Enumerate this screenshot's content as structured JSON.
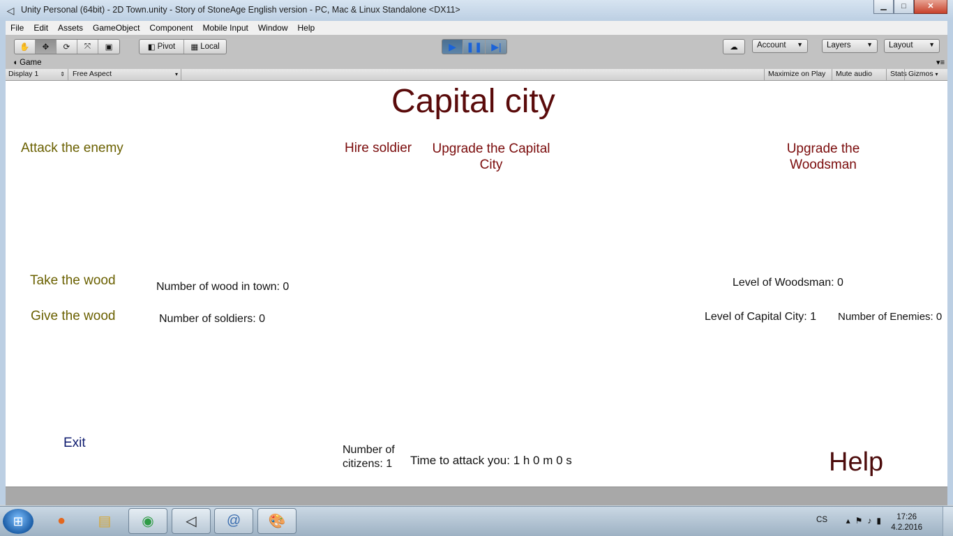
{
  "window": {
    "title": "Unity Personal (64bit) - 2D Town.unity - Story of StoneAge English version - PC, Mac & Linux Standalone <DX11>",
    "minimize_glyph": "▁",
    "maximize_glyph": "□",
    "close_glyph": "✕"
  },
  "menu": [
    "File",
    "Edit",
    "Assets",
    "GameObject",
    "Component",
    "Mobile Input",
    "Window",
    "Help"
  ],
  "toolbar": {
    "pivot_label": "Pivot",
    "local_label": "Local",
    "account_label": "Account",
    "layers_label": "Layers",
    "layout_label": "Layout"
  },
  "game_tab": {
    "label": "Game",
    "display": "Display 1",
    "aspect": "Free Aspect",
    "maximize_on_play": "Maximize on Play",
    "mute_audio": "Mute audio",
    "stats": "Stats",
    "gizmos": "Gizmos"
  },
  "game": {
    "heading": "Capital city",
    "attack_enemy": "Attack the enemy",
    "hire_soldier": "Hire soldier",
    "upgrade_capital_line1": "Upgrade the Capital",
    "upgrade_capital_line2": "City",
    "upgrade_woodsman_line1": "Upgrade the",
    "upgrade_woodsman_line2": "Woodsman",
    "take_wood": "Take the wood",
    "give_wood": "Give the wood",
    "wood_in_town": "Number of wood in town: 0",
    "soldiers": "Number of soldiers: 0",
    "woodsman_level": "Level of Woodsman: 0",
    "capital_level": "Level of Capital City: 1",
    "enemies": "Number of Enemies: 0",
    "exit": "Exit",
    "citizens_line1": "Number of",
    "citizens_line2": "citizens: 1",
    "time_to_attack": "Time to attack you: 1 h 0 m 0 s",
    "help": "Help"
  },
  "taskbar": {
    "language": "CS",
    "time": "17:26",
    "date": "4.2.2016"
  }
}
